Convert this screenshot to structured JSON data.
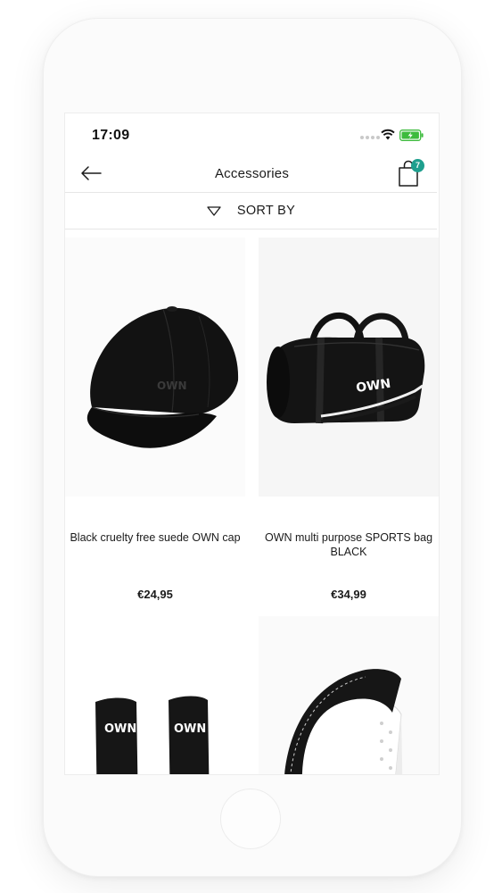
{
  "status_bar": {
    "time": "17:09"
  },
  "nav": {
    "title": "Accessories",
    "cart_count": "7"
  },
  "sort": {
    "label": "SORT BY"
  },
  "products": [
    {
      "name": "Black cruelty free suede OWN cap",
      "price": "€24,95",
      "image": "black-cap",
      "logo_text": "OWN"
    },
    {
      "name": "OWN multi purpose SPORTS bag BLACK",
      "price": "€34,99",
      "image": "black-sports-bag",
      "logo_text": "OWN"
    },
    {
      "name": "",
      "price": "",
      "image": "black-knee-sleeves",
      "logo_text": "OWN"
    },
    {
      "name": "",
      "price": "",
      "image": "black-lifting-belt",
      "logo_text": ""
    }
  ],
  "colors": {
    "badge": "#1e9f8e",
    "battery": "#3dbb3d"
  }
}
